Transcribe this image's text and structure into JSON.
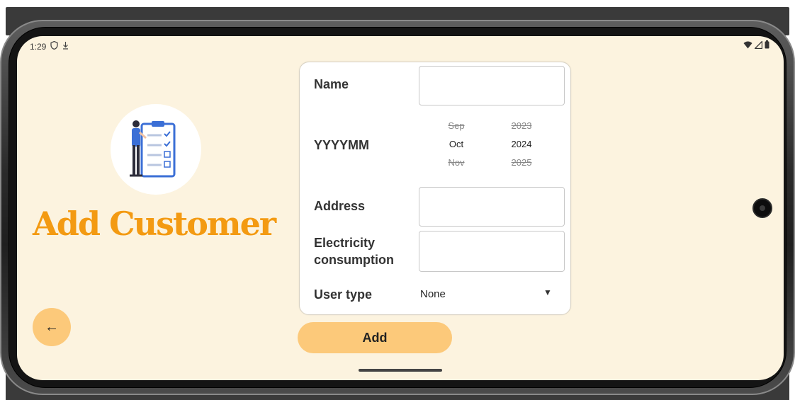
{
  "status_bar": {
    "time": "1:29",
    "left_icons": [
      "shield-icon",
      "download-icon"
    ],
    "right_icons": [
      "wifi-icon",
      "signal-icon",
      "battery-icon"
    ]
  },
  "page": {
    "title": "Add Customer",
    "back_icon": "←"
  },
  "form": {
    "name_label": "Name",
    "name_value": "",
    "date_label": "YYYYMM",
    "month_picker": {
      "prev": "Sep",
      "selected": "Oct",
      "next": "Nov"
    },
    "year_picker": {
      "prev": "2023",
      "selected": "2024",
      "next": "2025"
    },
    "address_label": "Address",
    "address_value": "",
    "consumption_label_line1": "Electricity",
    "consumption_label_line2": "consumption",
    "consumption_value": "",
    "user_type_label": "User type",
    "user_type_value": "None"
  },
  "actions": {
    "add_label": "Add"
  },
  "colors": {
    "background": "#fcf3df",
    "accent": "#f39a12",
    "button": "#fcc97a"
  }
}
